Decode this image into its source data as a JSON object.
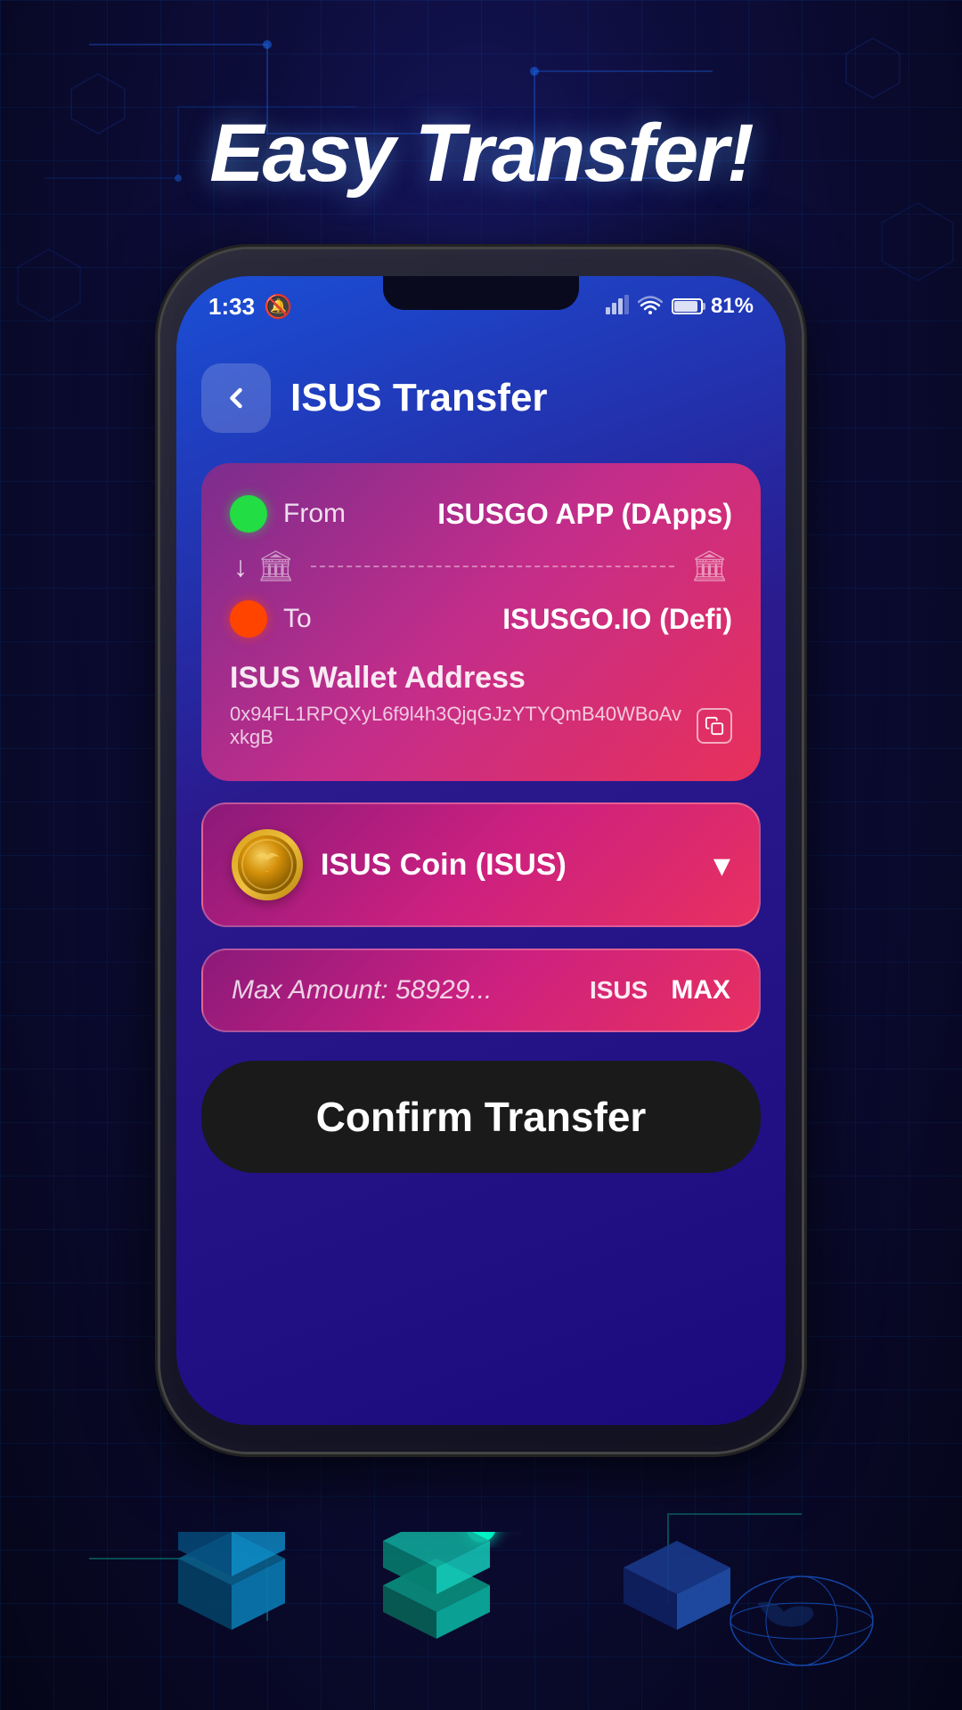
{
  "hero": {
    "title": "Easy Transfer!"
  },
  "status_bar": {
    "time": "1:33",
    "mute_icon": "🔕",
    "signal": "▌▌",
    "wifi": "wifi",
    "battery_level": "81%"
  },
  "header": {
    "back_label": "‹",
    "title": "ISUS Transfer"
  },
  "transfer_card": {
    "from_label": "From",
    "from_source": "ISUSGO APP (DApps)",
    "to_label": "To",
    "to_dest": "ISUSGO.IO (Defi)",
    "wallet_section_title": "ISUS Wallet Address",
    "wallet_address": "0x94FL1RPQXyL6f9l4h3QjqGJzYTYQmB40WBoAvxkgB",
    "copy_icon_label": "copy"
  },
  "coin_selector": {
    "label": "ISUS Coin (ISUS)",
    "dropdown_icon": "▾"
  },
  "amount_field": {
    "label": "Max Amount: 58929...",
    "currency": "ISUS",
    "max_label": "MAX"
  },
  "confirm_button": {
    "label": "Confirm Transfer"
  }
}
